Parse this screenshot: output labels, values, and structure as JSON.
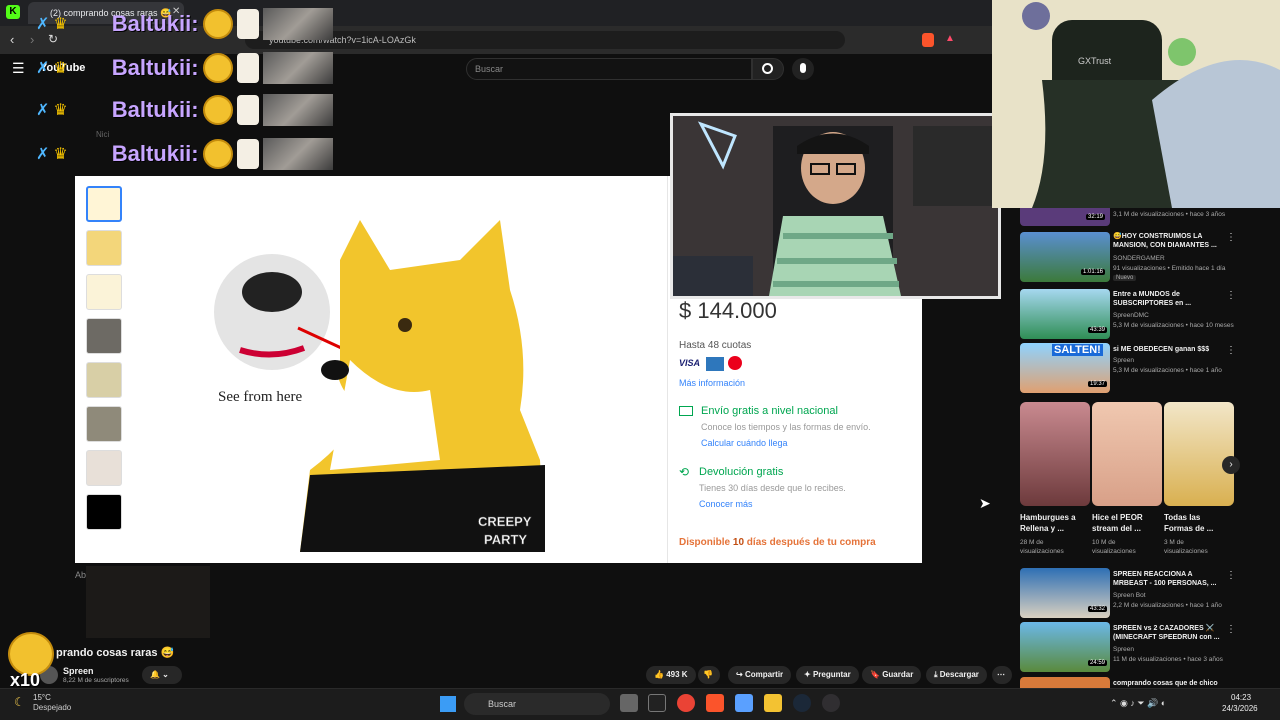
{
  "browser": {
    "tab_title": "(2) comprando cosas raras 😅",
    "address": "youtube.com/watch?v=1icA-LOAzGk"
  },
  "youtube": {
    "logo": "YouTube",
    "search_placeholder": "Buscar"
  },
  "chat": {
    "username": "Baltukii:",
    "lines": 4
  },
  "overlay": {
    "behind_name": "Nici",
    "open_original": "Abrir original"
  },
  "product": {
    "see_from_here": "See from here",
    "watermark_line1": "CREEPY",
    "watermark_line2": "PARTY",
    "price": "$ 144.000",
    "installments": "Hasta 48 cuotas",
    "more_info": "Más información",
    "shipping_title": "Envío gratis a nivel nacional",
    "shipping_desc": "Conoce los tiempos y las formas de envío.",
    "shipping_link": "Calcular cuándo llega",
    "return_title": "Devolución gratis",
    "return_desc": "Tienes 30 días desde que lo recibes.",
    "return_link": "Conocer más",
    "availability_prefix": "Disponible ",
    "availability_days": "10",
    "availability_suffix": " días después de tu compra",
    "cam_brand": "GXTrust"
  },
  "sidebar": {
    "top_meta": "3,1 M de visualizaciones • hace 3 años",
    "top_duration": "32:19",
    "videos": [
      {
        "title": "😅HOY CONSTRUIMOS LA MANSION, CON DIAMANTES ...",
        "channel": "SONDERGAMER",
        "meta": "91 visualizaciones • Emitido hace 1 día",
        "badge": "Nuevo",
        "duration": "1:01:16"
      },
      {
        "title": "Entre a MUNDOS de SUBSCRIPTORES en ...",
        "channel": "SpreenDMC",
        "meta": "5,3 M de visualizaciones • hace 10 meses",
        "duration": "43:39"
      },
      {
        "title": "si ME OBEDECEN ganan $$$",
        "channel": "Spreen",
        "meta": "5,3 M de visualizaciones • hace 1 año",
        "duration": "19:37",
        "thumb_text": "SALTEN!"
      }
    ],
    "shorts": [
      {
        "title": "Hamburgues a Rellena y ...",
        "meta": "28 M de visualizaciones"
      },
      {
        "title": "Hice el PEOR stream del ...",
        "meta": "10 M de visualizaciones"
      },
      {
        "title": "Todas las Formas de ...",
        "meta": "3 M de visualizaciones"
      }
    ],
    "videos2": [
      {
        "title": "SPREEN REACCIONA A MRBEAST - 100 PERSONAS, ...",
        "channel": "Spreen Bot",
        "meta": "2,2 M de visualizaciones • hace 1 año",
        "duration": "43:32"
      },
      {
        "title": "SPREEN vs 2 CAZADORES ⚔️ (MINECRAFT SPEEDRUN con ...",
        "channel": "Spreen",
        "meta": "11 M de visualizaciones • hace 3 años",
        "duration": "24:59"
      },
      {
        "title": "comprando cosas que de chico",
        "channel": "",
        "meta": "",
        "duration": ""
      }
    ]
  },
  "video": {
    "title": "prando cosas raras 😅",
    "channel": "Spreen",
    "subs": "8,22 M de suscriptores",
    "likes": "493 K",
    "share": "Compartir",
    "ask": "Preguntar",
    "save": "Guardar",
    "download": "Descargar"
  },
  "overlay_bottom": {
    "x10": "x10"
  },
  "taskbar": {
    "temp": "15°C",
    "weather": "Despejado",
    "search": "Buscar",
    "time": "04:23",
    "date": "24/3/2026"
  }
}
